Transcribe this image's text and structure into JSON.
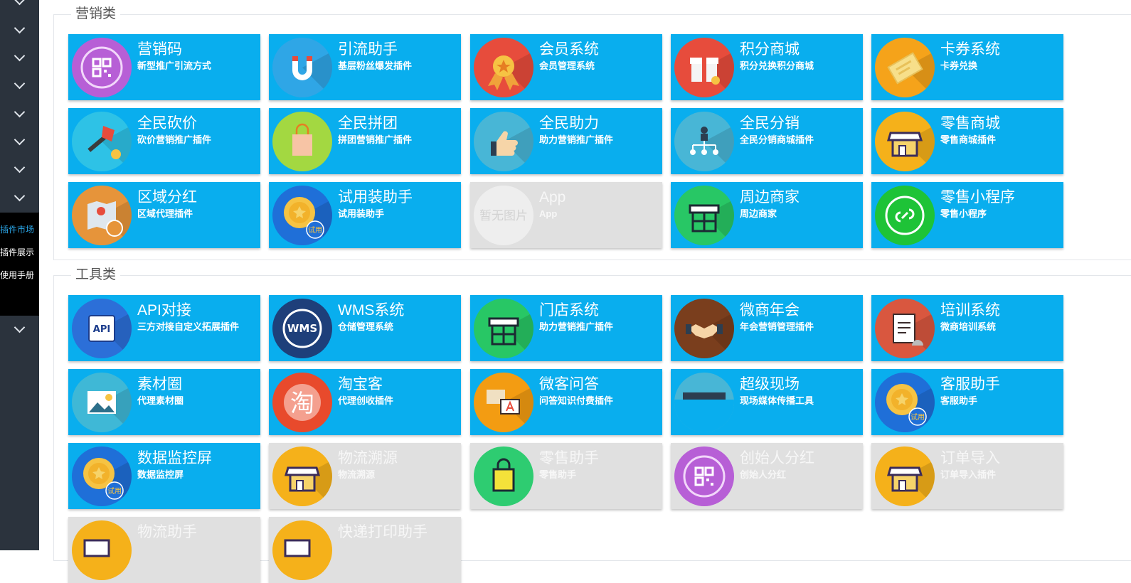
{
  "sidebar": {
    "submenu": [
      "插件市场",
      "插件展示",
      "使用手册"
    ]
  },
  "marketing": {
    "legend": "营销类",
    "tiles": [
      {
        "name": "营销码",
        "desc": "新型推广引流方式",
        "icon": "qrcode-icon",
        "state": "enabled"
      },
      {
        "name": "引流助手",
        "desc": "基层粉丝爆发插件",
        "icon": "magnet-icon",
        "state": "enabled"
      },
      {
        "name": "会员系统",
        "desc": "会员管理系统",
        "icon": "medal-icon",
        "state": "enabled"
      },
      {
        "name": "积分商城",
        "desc": "积分兑换积分商城",
        "icon": "gift-icon",
        "state": "enabled"
      },
      {
        "name": "卡券系统",
        "desc": "卡券兑换",
        "icon": "coupon-icon",
        "state": "enabled"
      },
      {
        "name": "全民砍价",
        "desc": "砍价营销推广插件",
        "icon": "axe-icon",
        "state": "enabled"
      },
      {
        "name": "全民拼团",
        "desc": "拼团营销推广插件",
        "icon": "shopping-bag-icon",
        "state": "enabled"
      },
      {
        "name": "全民助力",
        "desc": "助力营销推广插件",
        "icon": "thumbs-up-icon",
        "state": "enabled"
      },
      {
        "name": "全民分销",
        "desc": "全民分销商城插件",
        "icon": "org-chart-icon",
        "state": "enabled"
      },
      {
        "name": "零售商城",
        "desc": "零售商城插件",
        "icon": "storefront-icon",
        "state": "enabled"
      },
      {
        "name": "区域分红",
        "desc": "区域代理插件",
        "icon": "map-handshake-icon",
        "state": "enabled"
      },
      {
        "name": "试用装助手",
        "desc": "试用装助手",
        "icon": "trial-badge-icon",
        "state": "enabled"
      },
      {
        "name": "App",
        "desc": "App",
        "icon": "no-image-placeholder",
        "icon_text": "暂无图片",
        "state": "disabled"
      },
      {
        "name": "周边商家",
        "desc": "周边商家",
        "icon": "nearby-store-icon",
        "state": "enabled"
      },
      {
        "name": "零售小程序",
        "desc": "零售小程序",
        "icon": "mini-program-icon",
        "state": "enabled"
      }
    ]
  },
  "tools": {
    "legend": "工具类",
    "tiles": [
      {
        "name": "API对接",
        "desc": "三方对接自定义拓展插件",
        "icon": "api-chip-icon",
        "icon_text": "API",
        "state": "enabled"
      },
      {
        "name": "WMS系统",
        "desc": "仓储管理系统",
        "icon": "wms-icon",
        "icon_text": "WMS",
        "state": "enabled"
      },
      {
        "name": "门店系统",
        "desc": "助力营销推广插件",
        "icon": "nearby-store-icon",
        "state": "enabled"
      },
      {
        "name": "微商年会",
        "desc": "年会营销管理插件",
        "icon": "handshake-icon",
        "state": "enabled"
      },
      {
        "name": "培训系统",
        "desc": "微商培训系统",
        "icon": "clipboard-bell-icon",
        "state": "enabled"
      },
      {
        "name": "素材圈",
        "desc": "代理素材圈",
        "icon": "picture-icon",
        "state": "enabled"
      },
      {
        "name": "淘宝客",
        "desc": "代理创收插件",
        "icon": "taobao-icon",
        "icon_text": "淘",
        "state": "enabled"
      },
      {
        "name": "微客问答",
        "desc": "问答知识付费插件",
        "icon": "qa-icon",
        "state": "enabled"
      },
      {
        "name": "超级现场",
        "desc": "现场媒体传播工具",
        "icon": "live-screen-icon",
        "state": "enabled"
      },
      {
        "name": "客服助手",
        "desc": "客服助手",
        "icon": "trial-badge-icon",
        "state": "enabled"
      },
      {
        "name": "数据监控屏",
        "desc": "数据监控屏",
        "icon": "trial-badge-icon",
        "state": "enabled"
      },
      {
        "name": "物流溯源",
        "desc": "物流溯源",
        "icon": "storefront-icon",
        "state": "disabled"
      },
      {
        "name": "零售助手",
        "desc": "零售助手",
        "icon": "shopping-bag-icon",
        "state": "disabled"
      },
      {
        "name": "创始人分红",
        "desc": "创始人分红",
        "icon": "qrcode-icon",
        "state": "disabled"
      },
      {
        "name": "订单导入",
        "desc": "订单导入插件",
        "icon": "storefront-icon",
        "state": "disabled"
      },
      {
        "name": "物流助手",
        "desc": "",
        "icon": "truck-icon",
        "state": "disabled"
      },
      {
        "name": "快递打印助手",
        "desc": "",
        "icon": "truck-icon",
        "state": "disabled"
      }
    ],
    "trial_badge_text": "试用"
  },
  "colors": {
    "tile_enabled": "#09aeee",
    "tile_disabled": "#e0e0e0",
    "sidebar": "#2b333d",
    "submenu_active": "#2aa6e8"
  }
}
